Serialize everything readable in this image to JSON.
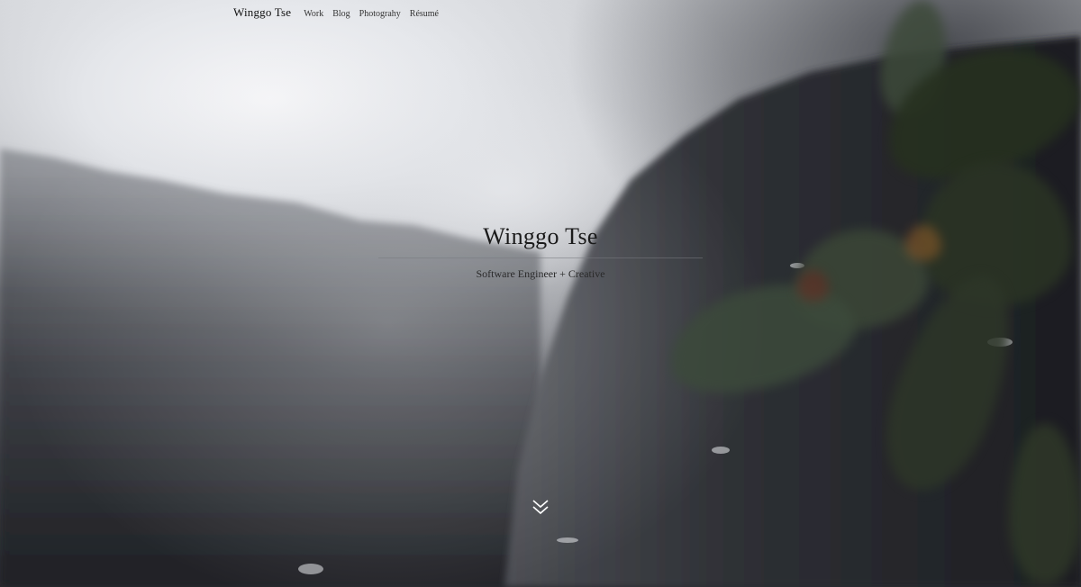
{
  "nav": {
    "brand": "Winggo Tse",
    "links": [
      "Work",
      "Blog",
      "Photograhy",
      "Résumé"
    ]
  },
  "hero": {
    "title": "Winggo Tse",
    "subtitle": "Software Engineer + Creative"
  },
  "icons": {
    "scroll": "double-chevron-down-icon"
  },
  "colors": {
    "text_dark": "#1a1a1a",
    "chevron": "#ffffff"
  }
}
